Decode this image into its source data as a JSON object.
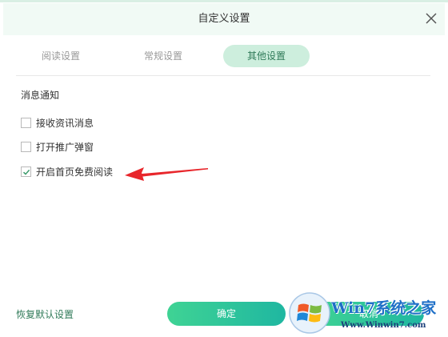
{
  "dialog": {
    "title": "自定义设置"
  },
  "tabs": [
    {
      "label": "阅读设置",
      "active": false
    },
    {
      "label": "常规设置",
      "active": false
    },
    {
      "label": "其他设置",
      "active": true
    }
  ],
  "section": {
    "title": "消息通知",
    "options": [
      {
        "label": "接收资讯消息",
        "checked": false
      },
      {
        "label": "打开推广弹窗",
        "checked": false
      },
      {
        "label": "开启首页免费阅读",
        "checked": true
      }
    ]
  },
  "footer": {
    "restore_label": "恢复默认设置",
    "ok_label": "确定",
    "cancel_label": "取消"
  },
  "watermark": {
    "text": "Win7系统之家",
    "url": "Www.Winwin7.com"
  },
  "colors": {
    "accent": "#2f7a58",
    "tab_active_bg": "#cdeedd",
    "button_gradient_start": "#3fd394",
    "button_gradient_end": "#1fb7a1",
    "annotation_arrow": "#e8262b"
  },
  "icons": {
    "close": "close-icon",
    "check": "checkmark-icon",
    "arrow": "red-arrow-annotation"
  }
}
